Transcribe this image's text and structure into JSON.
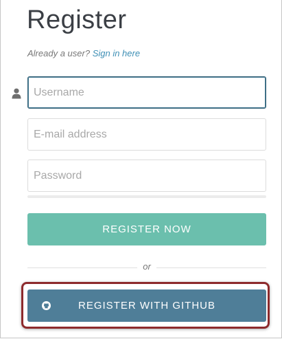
{
  "page": {
    "title": "Register",
    "already_text": "Already a user?",
    "sign_in_link": "Sign in here"
  },
  "form": {
    "username_placeholder": "Username",
    "email_placeholder": "E-mail address",
    "password_placeholder": "Password",
    "password_strength": 0
  },
  "buttons": {
    "register_now": "REGISTER NOW",
    "divider_text": "or",
    "register_github": "REGISTER WITH GITHUB"
  },
  "colors": {
    "register_button": "#6bbfad",
    "github_button": "#4f7e98",
    "highlight_border": "#8d2a2c",
    "link": "#3e8fb5"
  },
  "icons": {
    "username": "user-icon",
    "github": "github-icon"
  }
}
